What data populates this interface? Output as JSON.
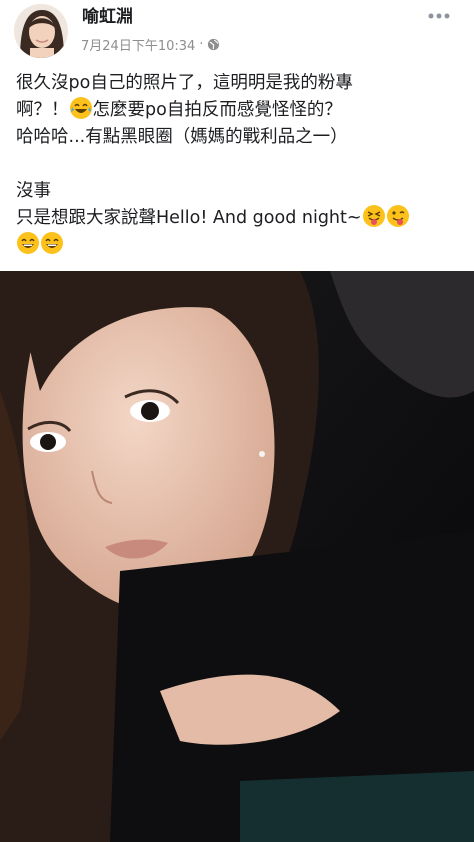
{
  "post": {
    "author": "喻虹淵",
    "timestamp": "7月24日下午10:34",
    "separator": "·",
    "privacy_icon": "globe-icon",
    "more_icon": "more-horizontal-icon",
    "text_lines": [
      "很久沒po自己的照片了，這明明是我的粉專",
      "啊？！",
      "怎麼要po自拍反而感覺怪怪的？",
      "哈哈哈...有點黑眼圈（媽媽的戰利品之一）",
      "沒事",
      "只是想跟大家說聲Hello! And good night~"
    ],
    "emojis": [
      "laughing-crying-emoji",
      "squinting-tongue-emoji",
      "winking-tongue-emoji",
      "grinning-emoji",
      "grinning-emoji"
    ]
  },
  "colors": {
    "text": "#1c1e21",
    "meta": "#8e8e8e",
    "emoji": "#fcc21b"
  }
}
